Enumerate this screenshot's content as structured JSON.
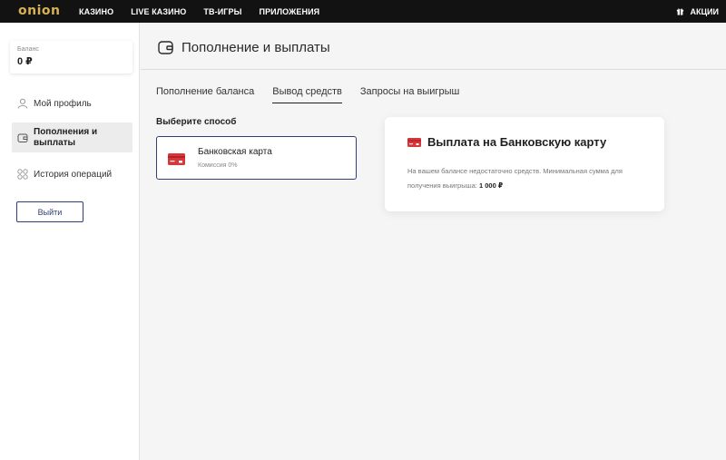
{
  "topbar": {
    "logo": "onion",
    "nav": [
      "КАЗИНО",
      "LIVE КАЗИНО",
      "ТВ-ИГРЫ",
      "ПРИЛОЖЕНИЯ"
    ],
    "promo_label": "АКЦИИ",
    "promo_icon": "gift-icon"
  },
  "sidebar": {
    "balance_label": "Баланс",
    "balance_value": "0 ₽",
    "items": [
      {
        "label": "Мой профиль",
        "icon": "user-icon"
      },
      {
        "label": "Пополнения и выплаты",
        "icon": "wallet-icon"
      },
      {
        "label": "История операций",
        "icon": "grid-icon"
      }
    ],
    "logout_label": "Выйти"
  },
  "main": {
    "title": "Пополнение и выплаты",
    "tabs": [
      "Пополнение баланса",
      "Вывод средств",
      "Запросы на выигрыш"
    ],
    "active_tab": "Вывод средств",
    "choose_label": "Выберите способ",
    "method": {
      "name": "Банковская карта",
      "fee": "Комиссия 0%"
    },
    "payout": {
      "title": "Выплата на Банковскую карту",
      "text": "На вашем балансе недостаточно средств. Минимальная сумма для получения выигрыша:",
      "min_amount": "1 000 ₽"
    }
  },
  "colors": {
    "accent": "#2f3f74",
    "logo": "#d6b156",
    "card_red": "#d6373a",
    "topbar": "#121212"
  }
}
